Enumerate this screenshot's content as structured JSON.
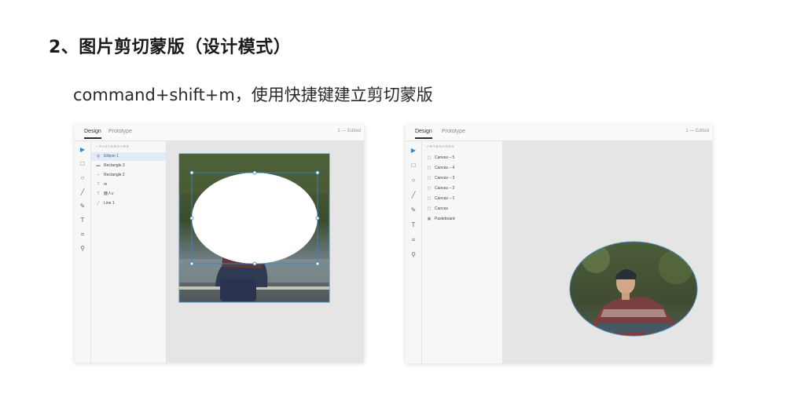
{
  "heading": "2、图片剪切蒙版（设计模式）",
  "subtitle": "command+shift+m，使用快捷键建立剪切蒙版",
  "left_window": {
    "tabs": [
      "Design",
      "Prototype"
    ],
    "doc_title": "1 — Edited",
    "layers_header": "PASTEBOARD",
    "layers": [
      {
        "label": "Ellipse 1",
        "icon": "ellipse-icon",
        "selected": true
      },
      {
        "label": "Rectangle 3",
        "icon": "folder-icon",
        "selected": false
      },
      {
        "label": "Rectangle 2",
        "icon": "rect-icon",
        "selected": false
      },
      {
        "label": "re",
        "icon": "text-icon",
        "selected": false
      },
      {
        "label": "鹿人v",
        "icon": "text-icon",
        "selected": false
      },
      {
        "label": "Line 1",
        "icon": "line-icon",
        "selected": false
      }
    ]
  },
  "right_window": {
    "tabs": [
      "Design",
      "Prototype"
    ],
    "doc_title": "1 — Edited",
    "layers_header": "ARTBOARDS",
    "layers": [
      {
        "label": "Canvas – 5",
        "icon": "artboard-icon"
      },
      {
        "label": "Canvas – 4",
        "icon": "artboard-icon"
      },
      {
        "label": "Canvas – 3",
        "icon": "artboard-icon"
      },
      {
        "label": "Canvas – 2",
        "icon": "artboard-icon"
      },
      {
        "label": "Canvas – 1",
        "icon": "artboard-icon"
      },
      {
        "label": "Canvas",
        "icon": "artboard-icon"
      },
      {
        "label": "Pasteboard",
        "icon": "pasteboard-icon"
      }
    ]
  },
  "toolbar": {
    "tools": [
      {
        "name": "select-tool",
        "glyph": "▶",
        "active": true
      },
      {
        "name": "rectangle-tool",
        "glyph": "□"
      },
      {
        "name": "ellipse-tool",
        "glyph": "○"
      },
      {
        "name": "line-tool",
        "glyph": "╱"
      },
      {
        "name": "pen-tool",
        "glyph": "✎"
      },
      {
        "name": "text-tool",
        "glyph": "T"
      },
      {
        "name": "artboard-tool",
        "glyph": "⌗"
      },
      {
        "name": "zoom-tool",
        "glyph": "⚲"
      }
    ]
  },
  "colors": {
    "accent": "#2d8ad2",
    "mask_outline": "#4a8ab8",
    "selection": "#e1ecf7"
  }
}
